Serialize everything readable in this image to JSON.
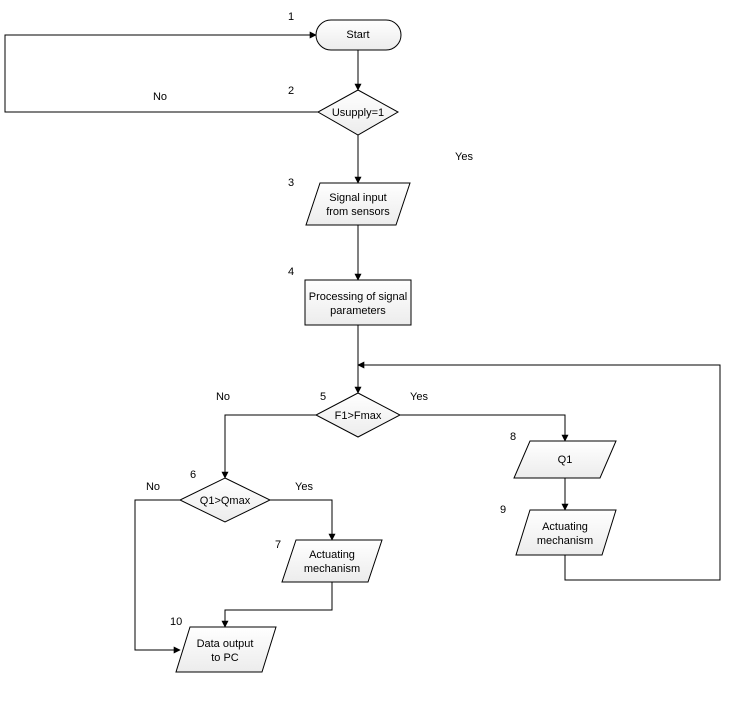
{
  "chart_data": {
    "type": "flowchart",
    "nodes": [
      {
        "id": 1,
        "shape": "terminator",
        "label": "Start"
      },
      {
        "id": 2,
        "shape": "decision",
        "label": "Usupply=1"
      },
      {
        "id": 3,
        "shape": "io",
        "label": "Signal input\nfrom sensors"
      },
      {
        "id": 4,
        "shape": "process",
        "label": "Processing of signal\nparameters"
      },
      {
        "id": 5,
        "shape": "decision",
        "label": "F1>Fmax"
      },
      {
        "id": 6,
        "shape": "decision",
        "label": "Q1>Qmax"
      },
      {
        "id": 7,
        "shape": "io",
        "label": "Actuating\nmechanism"
      },
      {
        "id": 8,
        "shape": "io",
        "label": "Q1"
      },
      {
        "id": 9,
        "shape": "io",
        "label": "Actuating\nmechanism"
      },
      {
        "id": 10,
        "shape": "io",
        "label": "Data output\nto PC"
      }
    ],
    "edges": [
      {
        "from": 1,
        "to": 2
      },
      {
        "from": 2,
        "to": 3,
        "label": "Yes"
      },
      {
        "from": 2,
        "to": 1,
        "label": "No",
        "loopback": true
      },
      {
        "from": 3,
        "to": 4
      },
      {
        "from": 4,
        "to": 5
      },
      {
        "from": 5,
        "to": 6,
        "label": "No"
      },
      {
        "from": 5,
        "to": 8,
        "label": "Yes"
      },
      {
        "from": 6,
        "to": 7,
        "label": "Yes"
      },
      {
        "from": 6,
        "to": 10,
        "label": "No"
      },
      {
        "from": 7,
        "to": 10
      },
      {
        "from": 8,
        "to": 9
      },
      {
        "from": 9,
        "to": 5,
        "loopback": true
      }
    ],
    "edge_labels": {
      "yes": "Yes",
      "no": "No"
    }
  }
}
